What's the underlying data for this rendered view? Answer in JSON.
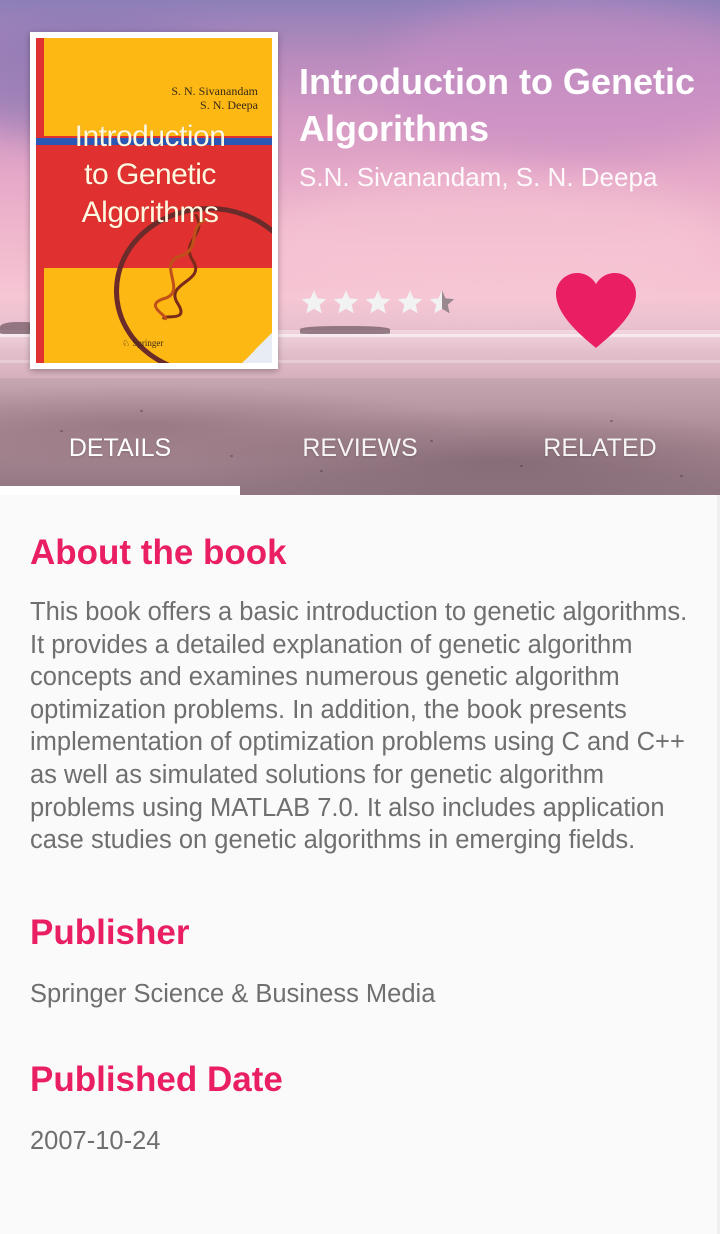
{
  "book": {
    "cover": {
      "authors_line1": "S. N. Sivanandam",
      "authors_line2": "S. N. Deepa",
      "title_line1": "Introduction",
      "title_line2": "to Genetic",
      "title_line3": "Algorithms",
      "publisher_logo_text": "Springer"
    },
    "title": "Introduction to Genetic Algorithms",
    "authors": "S.N. Sivanandam, S. N. Deepa",
    "rating": 4.5,
    "rating_max": 5,
    "favorite": true
  },
  "tabs": [
    {
      "label": "DETAILS",
      "active": true
    },
    {
      "label": "REVIEWS",
      "active": false
    },
    {
      "label": "RELATED",
      "active": false
    }
  ],
  "details": {
    "about_heading": "About the book",
    "about_text": "This book offers a basic introduction to genetic algorithms. It provides a detailed explanation of genetic algorithm concepts and examines numerous genetic algorithm optimization problems. In addition, the book presents implementation of optimization problems using C and C++ as well as simulated solutions for genetic algorithm problems using MATLAB 7.0. It also includes application case studies on genetic algorithms in emerging fields.",
    "publisher_heading": "Publisher",
    "publisher_value": "Springer Science & Business Media",
    "date_heading": "Published Date",
    "date_value": "2007-10-24"
  },
  "colors": {
    "accent": "#e91e63",
    "body_text": "#6f6f6f",
    "background": "#fafafa",
    "cover_yellow": "#fdb813",
    "cover_red": "#e0302f"
  },
  "icons": {
    "favorite": "heart-icon",
    "rating": "star-icon"
  }
}
